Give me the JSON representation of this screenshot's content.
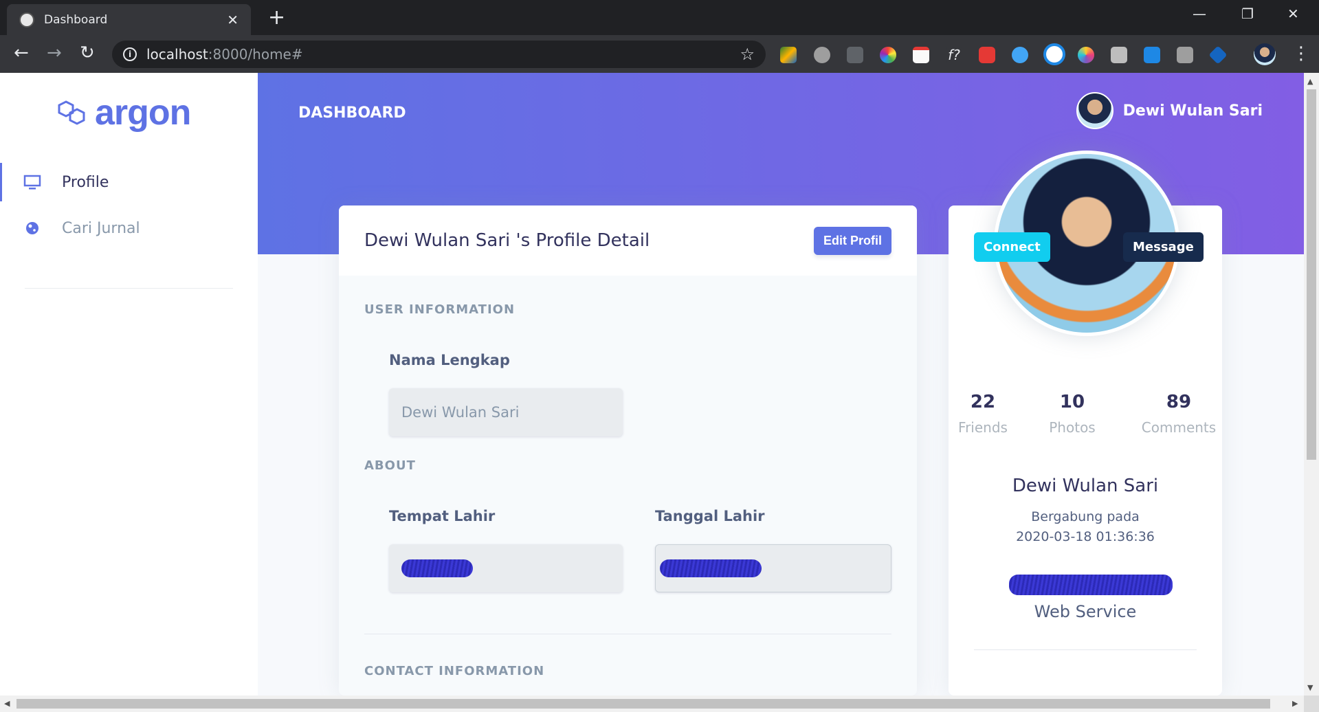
{
  "browser": {
    "tab_title": "Dashboard",
    "tab_close": "✕",
    "new_tab": "+",
    "url_host": "localhost",
    "url_path": ":8000/home#",
    "window_min": "—",
    "window_max": "❐",
    "window_close": "✕"
  },
  "sidebar": {
    "logo_text": "argon",
    "items": [
      {
        "label": "Profile",
        "icon": "monitor-icon"
      },
      {
        "label": "Cari Jurnal",
        "icon": "planet-icon"
      }
    ]
  },
  "header": {
    "breadcrumb": "DASHBOARD",
    "user_name": "Dewi Wulan Sari"
  },
  "profile_card": {
    "title": "Dewi Wulan Sari 's Profile Detail",
    "edit_button": "Edit Profil",
    "sections": {
      "user_info": "USER INFORMATION",
      "about": "ABOUT",
      "contact": "CONTACT INFORMATION"
    },
    "fields": {
      "nama_label": "Nama Lengkap",
      "nama_value": "Dewi Wulan Sari",
      "tempat_label": "Tempat Lahir",
      "tanggal_label": "Tanggal Lahir"
    }
  },
  "side_card": {
    "connect_button": "Connect",
    "message_button": "Message",
    "stats": [
      {
        "value": "22",
        "label": "Friends"
      },
      {
        "value": "10",
        "label": "Photos"
      },
      {
        "value": "89",
        "label": "Comments"
      }
    ],
    "name": "Dewi Wulan Sari",
    "joined_label": "Bergabung pada",
    "joined_date": "2020-03-18 01:36:36",
    "job": "Web Service"
  },
  "colors": {
    "primary": "#5e72e4",
    "gradient_end": "#825ee4",
    "info": "#11cdef",
    "dark": "#172b4d"
  }
}
